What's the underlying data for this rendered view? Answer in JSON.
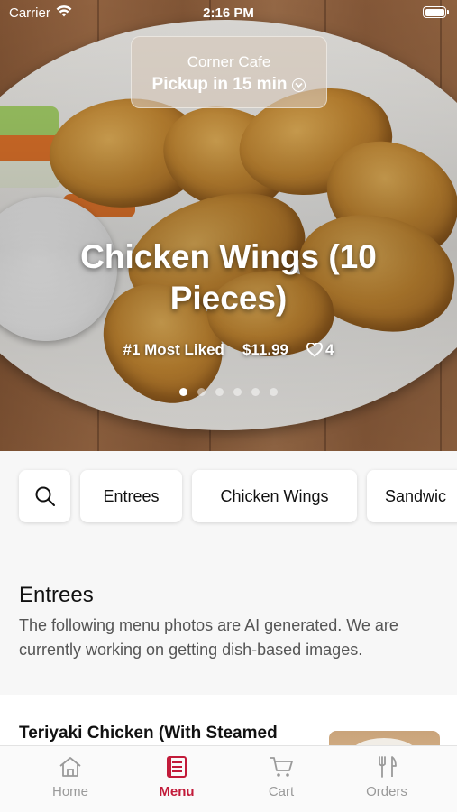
{
  "status_bar": {
    "carrier": "Carrier",
    "time": "2:16 PM"
  },
  "store": {
    "name": "Corner Cafe",
    "pickup": "Pickup in 15 min"
  },
  "featured": {
    "title": "Chicken Wings (10 Pieces)",
    "badge": "#1 Most Liked",
    "price": "$11.99",
    "likes": "4",
    "slide_count": 6,
    "active_slide": 1
  },
  "categories": [
    "Entrees",
    "Chicken Wings",
    "Sandwic"
  ],
  "section": {
    "title": "Entrees",
    "description": "The following menu photos are AI generated. We are currently working on getting dish-based images."
  },
  "items": [
    {
      "name": "Teriyaki Chicken (With Steamed"
    }
  ],
  "tabs": [
    {
      "label": "Home",
      "icon": "home-icon",
      "active": false
    },
    {
      "label": "Menu",
      "icon": "menu-book-icon",
      "active": true
    },
    {
      "label": "Cart",
      "icon": "cart-icon",
      "active": false
    },
    {
      "label": "Orders",
      "icon": "utensils-icon",
      "active": false
    }
  ],
  "colors": {
    "accent": "#c21b3a",
    "inactive": "#9a9a9a"
  }
}
